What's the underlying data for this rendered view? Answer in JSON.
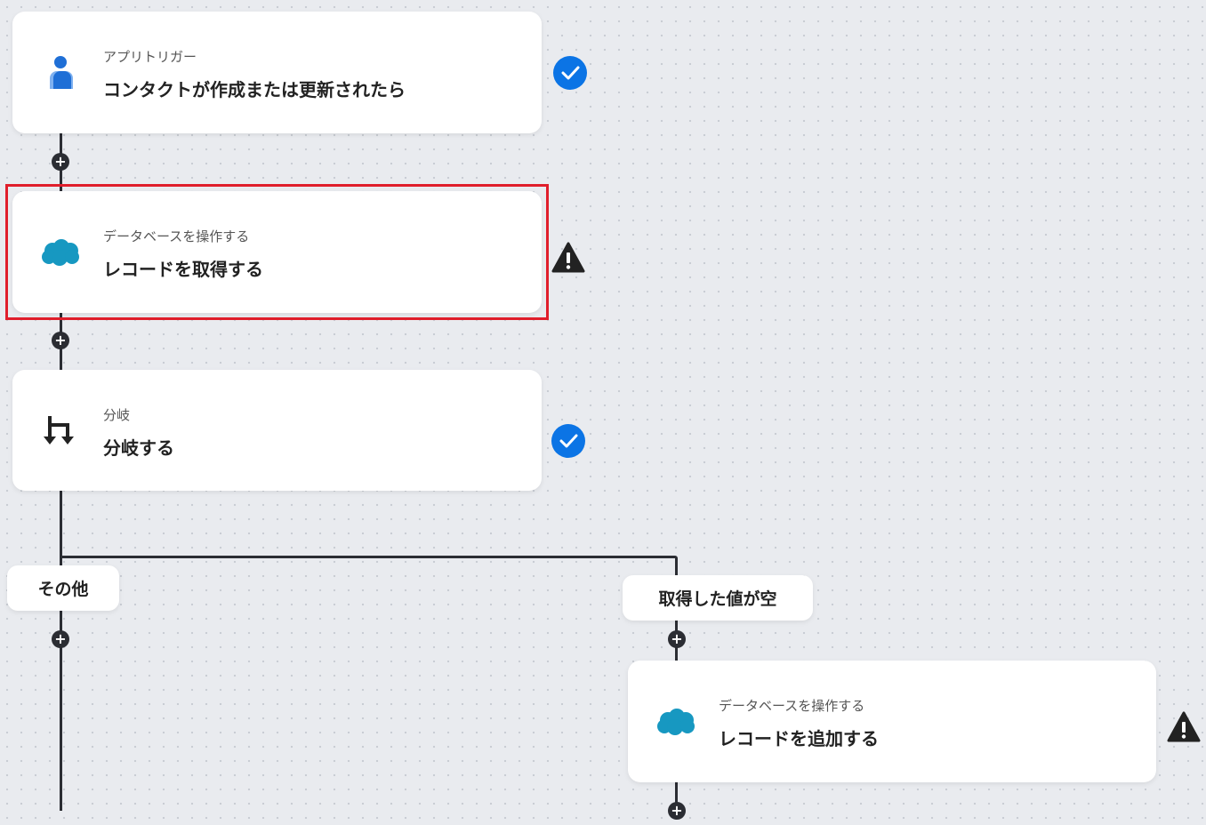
{
  "nodes": [
    {
      "subtitle": "アプリトリガー",
      "title": "コンタクトが作成または更新されたら",
      "icon": "contact-person-icon",
      "status": "check"
    },
    {
      "subtitle": "データベースを操作する",
      "title": "レコードを取得する",
      "icon": "salesforce-cloud-icon",
      "status": "warning"
    },
    {
      "subtitle": "分岐",
      "title": "分岐する",
      "icon": "branch-icon",
      "status": "check"
    },
    {
      "subtitle": "データベースを操作する",
      "title": "レコードを追加する",
      "icon": "salesforce-cloud-icon",
      "status": "warning"
    }
  ],
  "branches": {
    "left_label": "その他",
    "right_label": "取得した値が空"
  },
  "plus_symbol": "+",
  "colors": {
    "check": "#0b74e5",
    "warning": "#222222",
    "highlight": "#e01e2b",
    "salesforce": "#1798c1",
    "contact": "#1f6fd6"
  }
}
